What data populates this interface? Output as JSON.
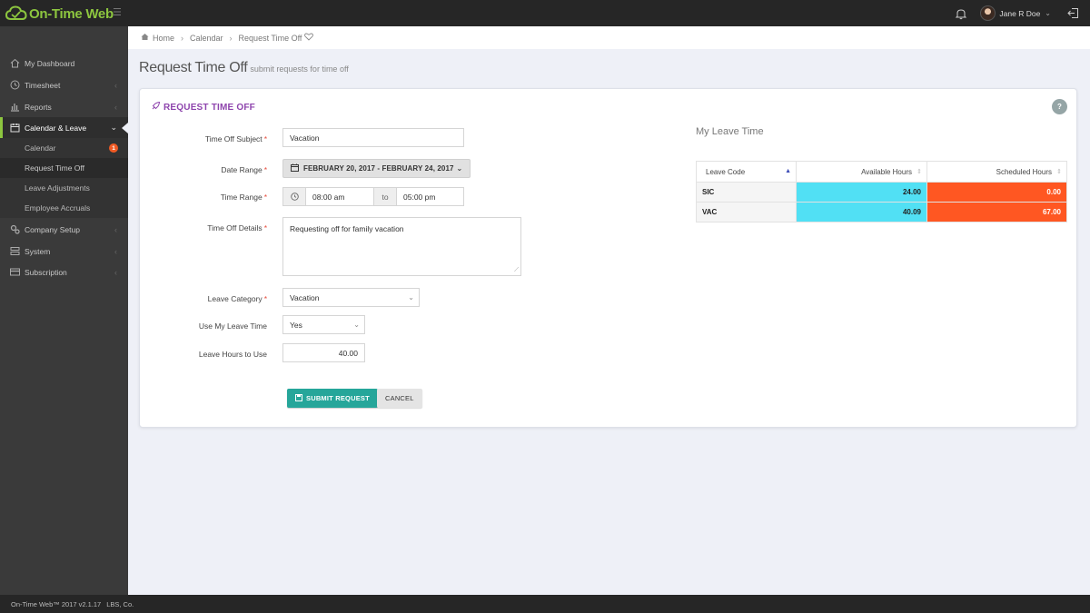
{
  "app": {
    "name": "On-Time Web",
    "user_name": "Jane R Doe"
  },
  "sidebar": {
    "items": [
      {
        "label": "My Dashboard"
      },
      {
        "label": "Timesheet"
      },
      {
        "label": "Reports"
      },
      {
        "label": "Calendar & Leave"
      },
      {
        "label": "Company Setup"
      },
      {
        "label": "System"
      },
      {
        "label": "Subscription"
      }
    ],
    "sub_items": [
      {
        "label": "Calendar",
        "badge": "1"
      },
      {
        "label": "Request Time Off"
      },
      {
        "label": "Leave Adjustments"
      },
      {
        "label": "Employee Accruals"
      }
    ]
  },
  "breadcrumb": {
    "home": "Home",
    "section": "Calendar",
    "current": "Request Time Off"
  },
  "page": {
    "title": "Request Time Off",
    "subtitle": "submit requests for time off"
  },
  "form": {
    "panel_title": "REQUEST TIME OFF",
    "help": "?",
    "subject_label": "Time Off Subject",
    "subject_value": "Vacation",
    "date_range_label": "Date Range",
    "date_range_value": "FEBRUARY 20, 2017 - FEBRUARY 24, 2017",
    "time_range_label": "Time Range",
    "time_start": "08:00 am",
    "time_to": "to",
    "time_end": "05:00 pm",
    "details_label": "Time Off Details",
    "details_value": "Requesting off for family vacation",
    "category_label": "Leave Category",
    "category_value": "Vacation",
    "use_leave_label": "Use My Leave Time",
    "use_leave_value": "Yes",
    "hours_label": "Leave Hours to Use",
    "hours_value": "40.00",
    "required_mark": "*",
    "submit_label": "SUBMIT REQUEST",
    "cancel_label": "CANCEL"
  },
  "leave_time": {
    "title": "My Leave Time",
    "headers": [
      "Leave Code",
      "Available Hours",
      "Scheduled Hours"
    ],
    "rows": [
      {
        "code": "SIC",
        "available": "24.00",
        "scheduled": "0.00"
      },
      {
        "code": "VAC",
        "available": "40.09",
        "scheduled": "67.00"
      }
    ],
    "colors": {
      "available": "#51e0f4",
      "scheduled": "#ff5722"
    }
  },
  "footer": {
    "version": "On-Time Web™ 2017 v2.1.17",
    "company": "LBS, Co."
  }
}
